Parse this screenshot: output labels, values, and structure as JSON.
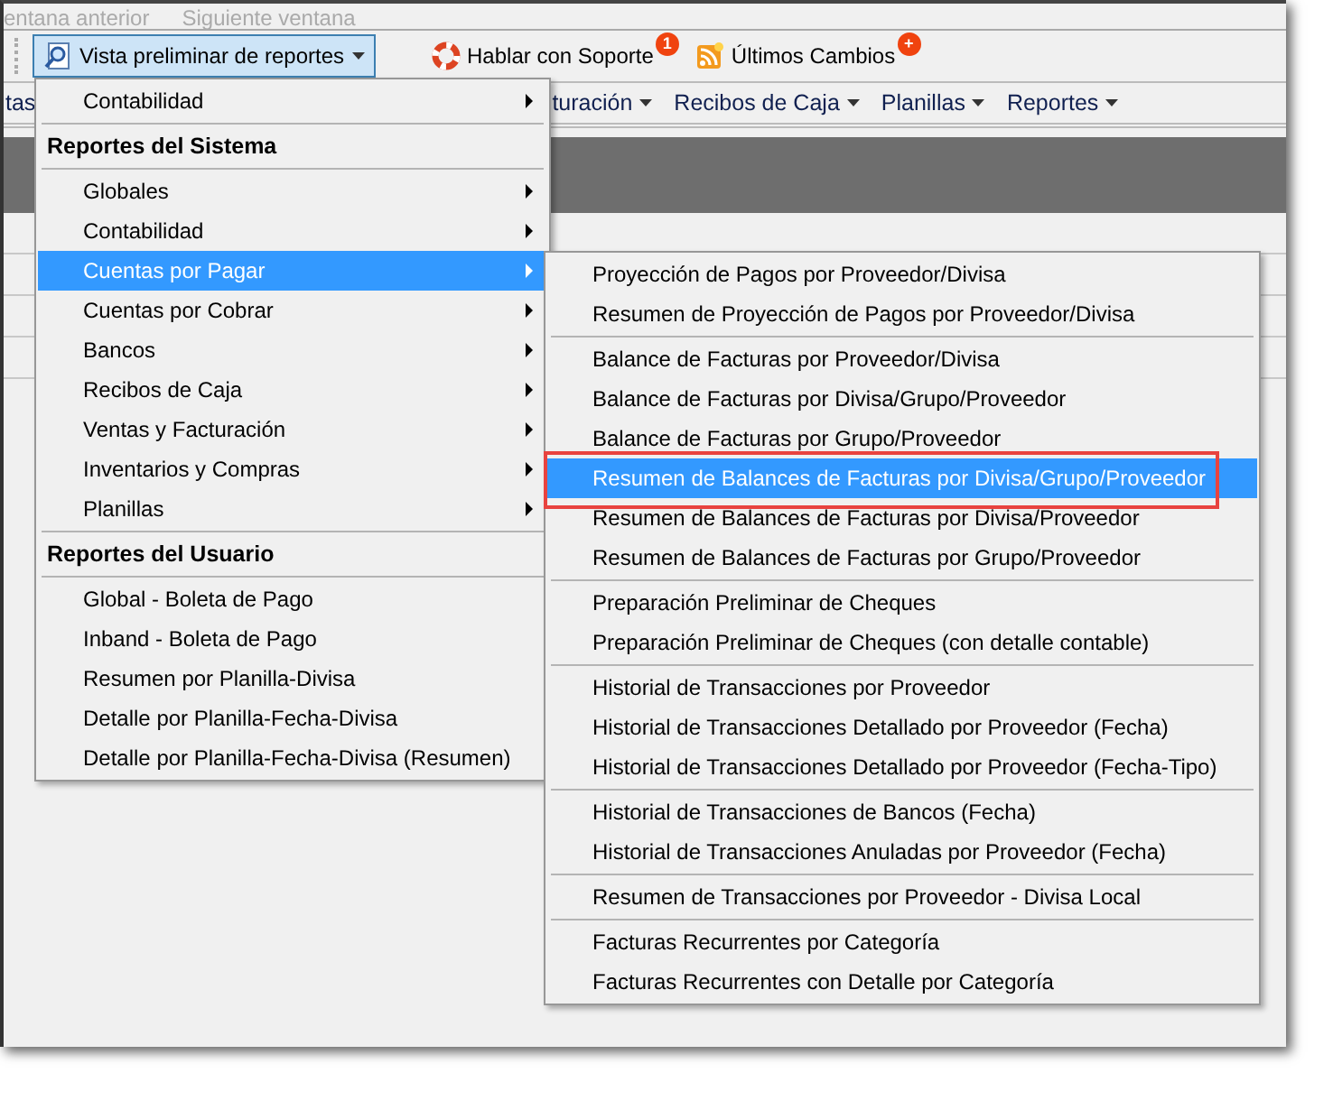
{
  "nav_bar": {
    "items": [
      {
        "label": "entana anterior",
        "disabled": true
      },
      {
        "label": "Siguiente ventana",
        "disabled": true
      }
    ]
  },
  "toolbar": {
    "items": [
      {
        "kind": "dropdown",
        "label": "Vista preliminar de reportes",
        "pressed": true
      },
      {
        "kind": "button",
        "label": "Hablar con Soporte",
        "badge": "1"
      },
      {
        "kind": "button",
        "label": "Últimos Cambios",
        "badge": "+"
      }
    ]
  },
  "menu_bar": {
    "items": [
      {
        "label": "tas",
        "caret": false
      },
      {
        "label": "turación",
        "caret": true
      },
      {
        "label": "Recibos de Caja",
        "caret": true
      },
      {
        "label": "Planillas",
        "caret": true
      },
      {
        "label": "Reportes",
        "caret": true
      }
    ]
  },
  "report_menu": {
    "items": [
      {
        "kind": "item",
        "label": "Contabilidad",
        "submenu": true,
        "selected": false
      },
      {
        "kind": "header",
        "label": "Reportes del Sistema"
      },
      {
        "kind": "item",
        "label": "Globales",
        "submenu": true,
        "selected": false
      },
      {
        "kind": "item",
        "label": "Contabilidad",
        "submenu": true,
        "selected": false
      },
      {
        "kind": "item",
        "label": "Cuentas por Pagar",
        "submenu": true,
        "selected": true
      },
      {
        "kind": "item",
        "label": "Cuentas por Cobrar",
        "submenu": true,
        "selected": false
      },
      {
        "kind": "item",
        "label": "Bancos",
        "submenu": true,
        "selected": false
      },
      {
        "kind": "item",
        "label": "Recibos de Caja",
        "submenu": true,
        "selected": false
      },
      {
        "kind": "item",
        "label": "Ventas y Facturación",
        "submenu": true,
        "selected": false
      },
      {
        "kind": "item",
        "label": "Inventarios y Compras",
        "submenu": true,
        "selected": false
      },
      {
        "kind": "item",
        "label": "Planillas",
        "submenu": true,
        "selected": false
      },
      {
        "kind": "header",
        "label": "Reportes del Usuario"
      },
      {
        "kind": "item",
        "label": "Global - Boleta de Pago",
        "submenu": false,
        "selected": false
      },
      {
        "kind": "item",
        "label": "Inband - Boleta de Pago",
        "submenu": false,
        "selected": false
      },
      {
        "kind": "item",
        "label": "Resumen por Planilla-Divisa",
        "submenu": false,
        "selected": false
      },
      {
        "kind": "item",
        "label": "Detalle por Planilla-Fecha-Divisa",
        "submenu": false,
        "selected": false
      },
      {
        "kind": "item",
        "label": "Detalle por Planilla-Fecha-Divisa (Resumen)",
        "submenu": false,
        "selected": false
      }
    ]
  },
  "submenu": {
    "groups": [
      {
        "items": [
          {
            "label": "Proyección de Pagos por Proveedor/Divisa",
            "selected": false
          },
          {
            "label": "Resumen de Proyección de Pagos por Proveedor/Divisa",
            "selected": false
          }
        ]
      },
      {
        "items": [
          {
            "label": "Balance de Facturas por Proveedor/Divisa",
            "selected": false
          },
          {
            "label": "Balance de Facturas por Divisa/Grupo/Proveedor",
            "selected": false
          },
          {
            "label": "Balance de Facturas por Grupo/Proveedor",
            "selected": false
          },
          {
            "label": "Resumen de Balances de Facturas por Divisa/Grupo/Proveedor",
            "selected": true
          },
          {
            "label": "Resumen de Balances de Facturas por Divisa/Proveedor",
            "selected": false
          },
          {
            "label": "Resumen de Balances de Facturas por Grupo/Proveedor",
            "selected": false
          }
        ]
      },
      {
        "items": [
          {
            "label": "Preparación Preliminar de Cheques",
            "selected": false
          },
          {
            "label": "Preparación Preliminar de Cheques (con detalle contable)",
            "selected": false
          }
        ]
      },
      {
        "items": [
          {
            "label": "Historial de Transacciones por Proveedor",
            "selected": false
          },
          {
            "label": "Historial de Transacciones Detallado por Proveedor (Fecha)",
            "selected": false
          },
          {
            "label": "Historial de Transacciones Detallado por Proveedor (Fecha-Tipo)",
            "selected": false
          }
        ]
      },
      {
        "items": [
          {
            "label": "Historial de Transacciones de Bancos (Fecha)",
            "selected": false
          },
          {
            "label": "Historial de Transacciones Anuladas por Proveedor (Fecha)",
            "selected": false
          }
        ]
      },
      {
        "items": [
          {
            "label": "Resumen de Transacciones por Proveedor - Divisa Local",
            "selected": false
          }
        ]
      },
      {
        "items": [
          {
            "label": "Facturas Recurrentes por Categoría",
            "selected": false
          },
          {
            "label": "Facturas Recurrentes con Detalle por Categoría",
            "selected": false
          }
        ]
      }
    ]
  }
}
